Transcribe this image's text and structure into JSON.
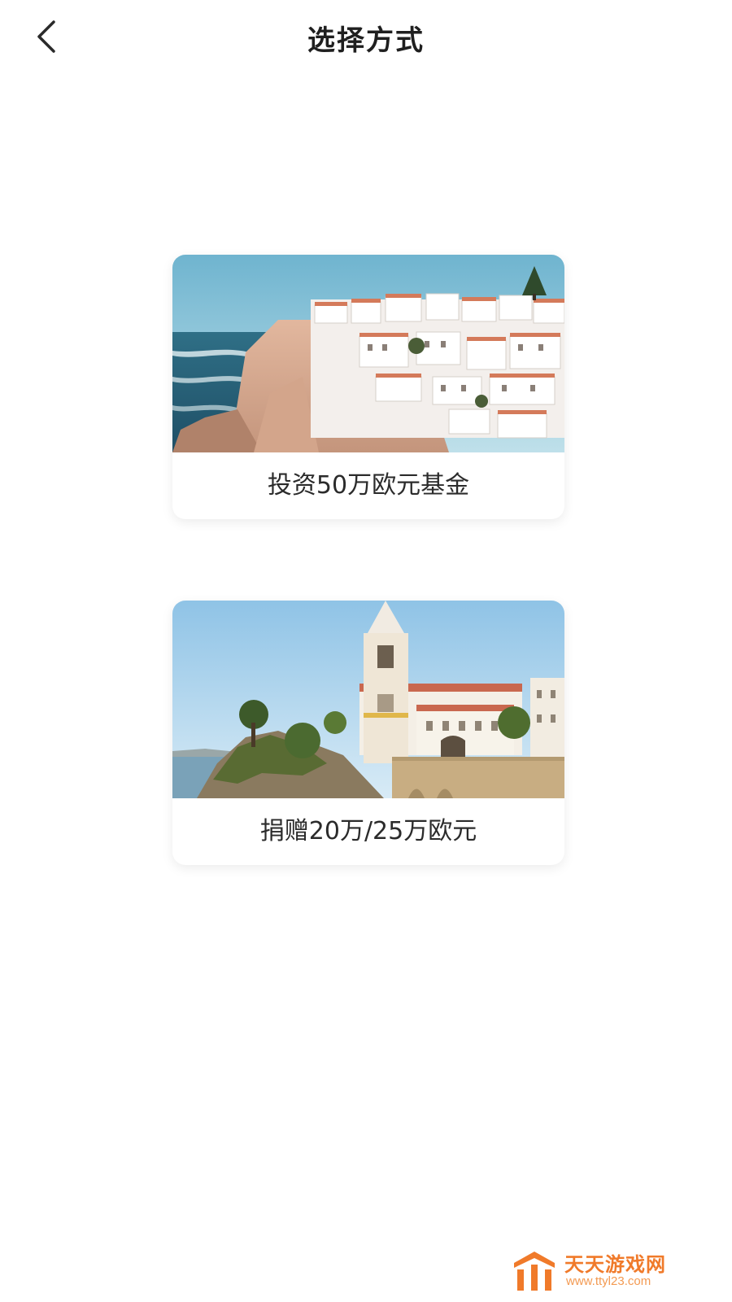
{
  "header": {
    "title": "选择方式",
    "back_icon": "chevron-left-icon"
  },
  "options": [
    {
      "label": "投资50万欧元基金",
      "image": "coastal-cliff-town-photo"
    },
    {
      "label": "捐赠20万/25万欧元",
      "image": "church-on-cliff-photo"
    }
  ],
  "watermark": {
    "brand": "天天游戏网",
    "url": "www.ttyl23.com",
    "color": "#f07a2a"
  },
  "colors": {
    "background": "#ffffff",
    "title": "#1f1f1f",
    "label": "#2b2b2b"
  }
}
